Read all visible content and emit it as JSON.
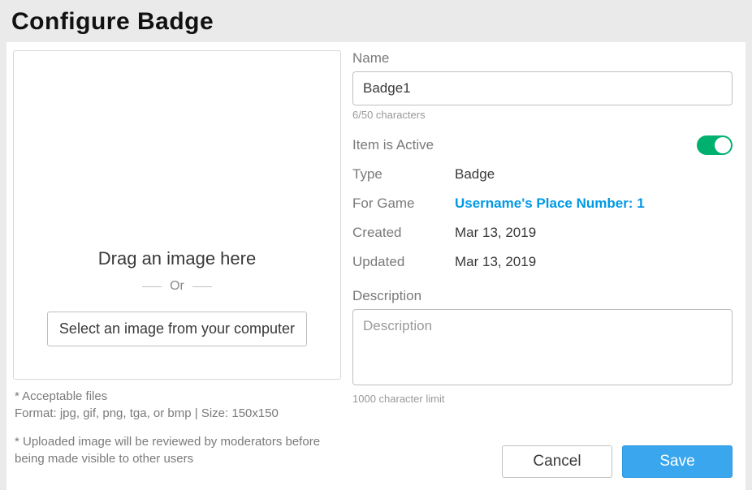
{
  "header": {
    "title": "Configure Badge"
  },
  "upload": {
    "drag_text": "Drag an image here",
    "or_text": "Or",
    "select_btn": "Select an image from your computer",
    "hint1_label": "* Acceptable files",
    "hint1_body": "Format: jpg, gif, png, tga, or bmp | Size: 150x150",
    "hint2": "* Uploaded image will be reviewed by moderators before being made visible to other users"
  },
  "form": {
    "name_label": "Name",
    "name_value": "Badge1",
    "name_helper": "6/50 characters",
    "active_label": "Item is Active",
    "active_value": true,
    "type_label": "Type",
    "type_value": "Badge",
    "game_label": "For Game",
    "game_value": "Username's Place Number: 1",
    "created_label": "Created",
    "created_value": "Mar 13, 2019",
    "updated_label": "Updated",
    "updated_value": "Mar 13, 2019",
    "desc_label": "Description",
    "desc_placeholder": "Description",
    "desc_value": "",
    "desc_helper": "1000 character limit"
  },
  "actions": {
    "cancel": "Cancel",
    "save": "Save"
  }
}
